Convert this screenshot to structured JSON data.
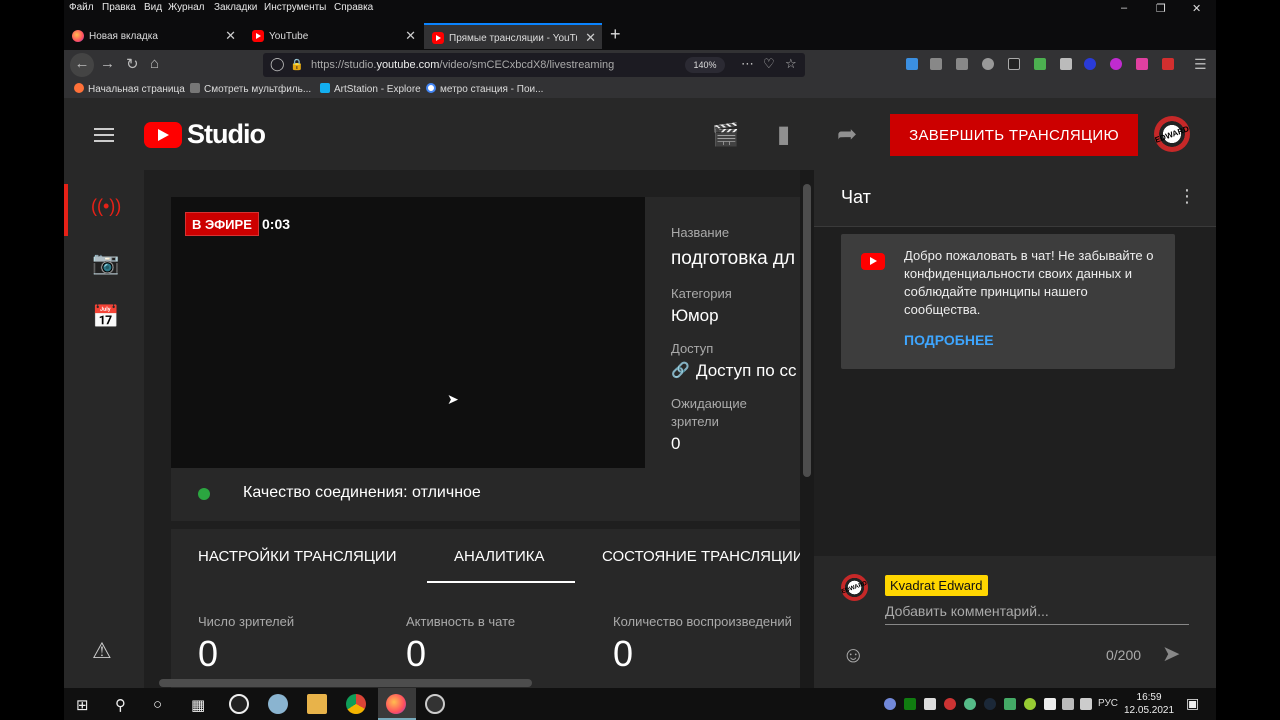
{
  "browser": {
    "menu": [
      "Файл",
      "Правка",
      "Вид",
      "Журнал",
      "Закладки",
      "Инструменты",
      "Справка"
    ],
    "tabs": [
      {
        "label": "Новая вкладка",
        "icon": "firefox-icon"
      },
      {
        "label": "YouTube",
        "icon": "youtube-icon"
      },
      {
        "label": "Прямые трансляции - YouTube",
        "icon": "youtube-icon",
        "active": true
      }
    ],
    "url_prefix": "https://studio.",
    "url_domain": "youtube.com",
    "url_path": "/video/smCECxbcdX8/livestreaming",
    "zoom": "140%",
    "bookmarks": [
      "Начальная страница",
      "Смотреть мультфиль...",
      "ArtStation - Explore",
      "метро станция - Пои..."
    ]
  },
  "studio": {
    "logo_text": "Studio",
    "end_button": "ЗАВЕРШИТЬ ТРАНСЛЯЦИЮ",
    "avatar_text": "EDWARD",
    "live_badge": "В ЭФИРЕ",
    "live_time": "0:03",
    "info": {
      "title_label": "Название",
      "title_value": "подготовка дл",
      "category_label": "Категория",
      "category_value": "Юмор",
      "access_label": "Доступ",
      "access_value": "Доступ по сс",
      "waiting_label_1": "Ожидающие",
      "waiting_label_2": "зрители",
      "waiting_value": "0"
    },
    "quality_text": "Качество соединения: отличное",
    "tabs": [
      "НАСТРОЙКИ ТРАНСЛЯЦИИ",
      "АНАЛИТИКА",
      "СОСТОЯНИЕ ТРАНСЛЯЦИИ"
    ],
    "metrics": [
      {
        "label": "Число зрителей",
        "value": "0"
      },
      {
        "label": "Активность в чате",
        "value": "0"
      },
      {
        "label": "Количество воспроизведений",
        "value": "0"
      }
    ]
  },
  "chat": {
    "title": "Чат",
    "welcome_text": "Добро пожаловать в чат! Не забывайте о конфиденциальности своих данных и соблюдайте принципы нашего сообщества.",
    "more_link": "ПОДРОБНЕЕ",
    "user_name": "Kvadrat Edward",
    "input_placeholder": "Добавить комментарий...",
    "char_count": "0/200"
  },
  "taskbar": {
    "lang": "РУС",
    "time": "16:59",
    "date": "12.05.2021"
  },
  "colors": {
    "accent": "#cc0000",
    "link": "#3ea6ff",
    "good": "#2ba640",
    "highlight": "#ffd600"
  }
}
